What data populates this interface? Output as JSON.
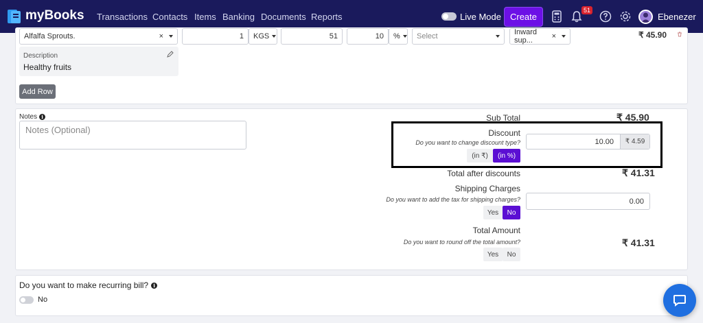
{
  "nav": {
    "app_name": "myBooks",
    "links": [
      "Transactions",
      "Contacts",
      "Items",
      "Banking",
      "Documents",
      "Reports"
    ],
    "live_mode_label": "Live Mode",
    "create_label": "Create",
    "notification_count": "51",
    "user_name": "Ebenezer"
  },
  "item_row": {
    "item_name": "Alfalfa Sprouts.",
    "quantity": "1",
    "unit": "KGS",
    "rate": "51",
    "discount": "10",
    "discount_unit": "%",
    "tax_placeholder": "Select",
    "supply_type": "Inward sup...",
    "row_amount": "₹ 45.90",
    "description_label": "Description",
    "description_value": "Healthy fruits",
    "add_row_label": "Add Row"
  },
  "totals": {
    "notes_label": "Notes",
    "notes_placeholder": "Notes (Optional)",
    "subtotal_label": "Sub Total",
    "subtotal_value": "₹ 45.90",
    "discount_label": "Discount",
    "discount_hint": "Do you want to change discount type?",
    "discount_input": "10.00",
    "discount_calc": "₹ 4.59",
    "discount_currency_opt": "(in ₹)",
    "discount_percent_opt": "(in %)",
    "total_after_discount_label": "Total after discounts",
    "total_after_discount_value": "₹ 41.31",
    "shipping_label": "Shipping Charges",
    "shipping_hint": "Do you want to add the tax for shipping charges?",
    "shipping_input": "0.00",
    "yes_label": "Yes",
    "no_label": "No",
    "total_amount_label": "Total Amount",
    "round_off_hint": "Do you want to round off the total amount?",
    "total_amount_value": "₹ 41.31"
  },
  "recurring": {
    "question": "Do you want to make recurring bill?",
    "toggle_label": "No"
  },
  "colors": {
    "navbar": "#1a1a5c",
    "accent": "#6c10e6",
    "badge": "#d9232e",
    "chat": "#1f6fe0"
  }
}
